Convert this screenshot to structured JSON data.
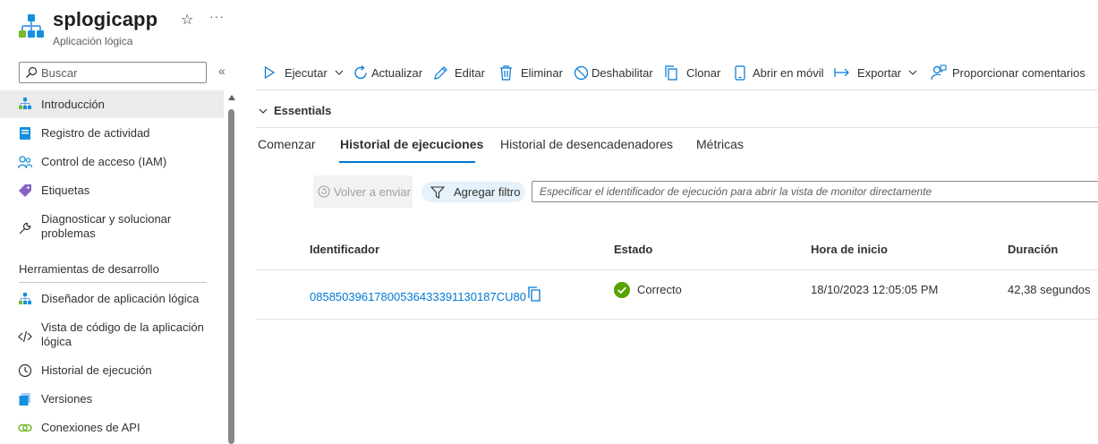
{
  "header": {
    "title": "splogicapp",
    "subtitle": "Aplicación lógica",
    "app_icon": "logic-app-icon",
    "star_icon": "☆",
    "more_icon": "···"
  },
  "sidebar": {
    "search_placeholder": "Buscar",
    "collapse_icon": "«",
    "items": [
      {
        "label": "Introducción",
        "icon": "logic-app-icon",
        "active": true
      },
      {
        "label": "Registro de actividad",
        "icon": "activity-log-icon"
      },
      {
        "label": "Control de acceso (IAM)",
        "icon": "iam-icon"
      },
      {
        "label": "Etiquetas",
        "icon": "tag-icon"
      },
      {
        "label": "Diagnosticar y solucionar problemas",
        "icon": "wrench-icon"
      }
    ],
    "section_title": "Herramientas de desarrollo",
    "dev_items": [
      {
        "label": "Diseñador de aplicación lógica",
        "icon": "designer-icon"
      },
      {
        "label": "Vista de código de la aplicación lógica",
        "icon": "code-icon"
      },
      {
        "label": "Historial de ejecución",
        "icon": "history-icon"
      },
      {
        "label": "Versiones",
        "icon": "versions-icon"
      },
      {
        "label": "Conexiones de API",
        "icon": "api-connections-icon"
      }
    ]
  },
  "toolbar": {
    "run": "Ejecutar",
    "refresh": "Actualizar",
    "edit": "Editar",
    "delete": "Eliminar",
    "disable": "Deshabilitar",
    "clone": "Clonar",
    "mobile": "Abrir en móvil",
    "export": "Exportar",
    "feedback": "Proporcionar comentarios"
  },
  "essentials": {
    "label": "Essentials"
  },
  "tabs": [
    {
      "label": "Comenzar",
      "active": false
    },
    {
      "label": "Historial de ejecuciones",
      "active": true
    },
    {
      "label": "Historial de desencadenadores",
      "active": false
    },
    {
      "label": "Métricas",
      "active": false
    }
  ],
  "filters": {
    "resubmit": "Volver a enviar",
    "add_filter": "Agregar filtro",
    "run_id_placeholder": "Especificar el identificador de ejecución para abrir la vista de monitor directamente"
  },
  "table": {
    "columns": [
      "Identificador",
      "Estado",
      "Hora de inicio",
      "Duración"
    ],
    "rows": [
      {
        "id": "08585039617800536433391130187CU80",
        "status": "Correcto",
        "start_time": "18/10/2023 12:05:05 PM",
        "duration": "42,38 segundos"
      }
    ]
  },
  "colors": {
    "accent": "#0078d4",
    "success": "#57a300",
    "logic_app_blue": "#1490df",
    "logic_app_green": "#5ea0ef"
  }
}
